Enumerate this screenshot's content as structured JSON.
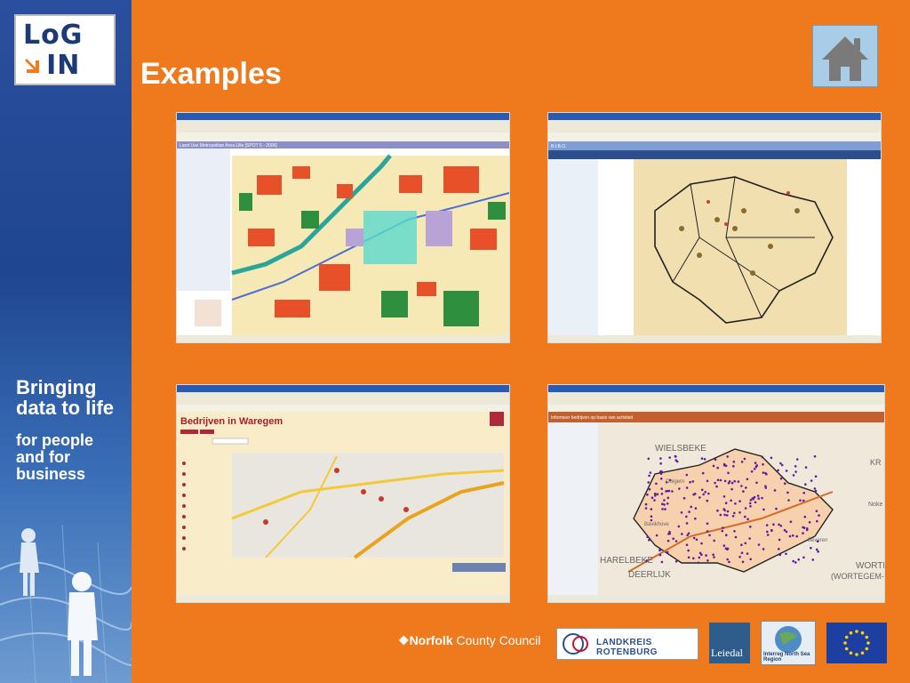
{
  "logo": {
    "line1": "LoG",
    "line2": "IN"
  },
  "title": "Examples",
  "tagline": {
    "line1": "Bringing",
    "line2": "data to life",
    "line3": "for people",
    "line4": "and for",
    "line5": "business"
  },
  "screens": [
    {
      "app_title": "Land Use Metropolitan Area Lille [SPOT 5 - 2006]"
    },
    {
      "app_title": "B.I.B.O."
    },
    {
      "app_title": "Bedrijven in Waregem"
    },
    {
      "app_title": "Informeer bedrijven op basis van activiteit"
    }
  ],
  "map_labels": {
    "wielsbeke": "WIELSBEKE",
    "harelbeke": "HARELBEKE",
    "deerlijk": "DEERLIJK",
    "worte": "WORTE",
    "wortegem": "(WORTEGEM-P",
    "kr": "KR",
    "nok": "Noke",
    "bavikhove": "Bavikhove",
    "ooigem": "Ooigem",
    "beveren": "Beveren"
  },
  "partners": {
    "norfolk_bold": "Norfolk",
    "norfolk_rest": "County Council",
    "rotenburg": "LANDKREIS ROTENBURG",
    "leiedal": "Leiedal",
    "interreg": "Interreg North Sea Region"
  },
  "colors": {
    "background": "#ef7a1e",
    "sidebar": "#2a4f9e",
    "title_text": "#ffffff"
  }
}
